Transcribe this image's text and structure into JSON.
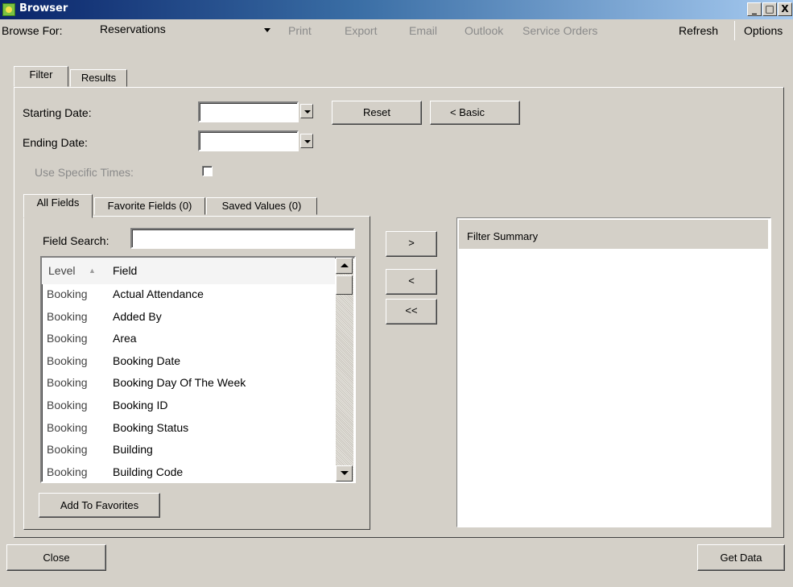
{
  "window": {
    "title": "Browser",
    "min_label": "_",
    "max_label": "□",
    "close_label": "X"
  },
  "toolbar": {
    "browse_for_label": "Browse For:",
    "browse_for_value": "Reservations",
    "print": "Print",
    "export": "Export",
    "email": "Email",
    "outlook": "Outlook",
    "service_orders": "Service Orders",
    "refresh": "Refresh",
    "options": "Options"
  },
  "tabs": {
    "filter": "Filter",
    "results": "Results"
  },
  "filter": {
    "starting_date_label": "Starting Date:",
    "ending_date_label": "Ending Date:",
    "use_specific_times_label": "Use Specific Times:",
    "starting_date_value": "",
    "ending_date_value": "",
    "reset": "Reset",
    "basic": "< Basic"
  },
  "field_tabs": {
    "all": "All Fields",
    "favorite": "Favorite Fields (0)",
    "saved": "Saved Values (0)"
  },
  "field_search": {
    "label": "Field Search:",
    "value": ""
  },
  "list": {
    "col_level": "Level",
    "col_field": "Field",
    "sort_indicator": "▲",
    "rows": [
      {
        "level": "Booking",
        "field": "Actual Attendance"
      },
      {
        "level": "Booking",
        "field": "Added By"
      },
      {
        "level": "Booking",
        "field": "Area"
      },
      {
        "level": "Booking",
        "field": "Booking Date"
      },
      {
        "level": "Booking",
        "field": "Booking Day Of The Week"
      },
      {
        "level": "Booking",
        "field": "Booking ID"
      },
      {
        "level": "Booking",
        "field": "Booking Status"
      },
      {
        "level": "Booking",
        "field": "Building"
      },
      {
        "level": "Booking",
        "field": "Building Code"
      }
    ]
  },
  "add_to_favorites": "Add To Favorites",
  "move_buttons": {
    "add": ">",
    "remove": "<",
    "remove_all": "<<"
  },
  "filter_summary": {
    "title": "Filter Summary"
  },
  "footer": {
    "close": "Close",
    "get_data": "Get Data"
  }
}
